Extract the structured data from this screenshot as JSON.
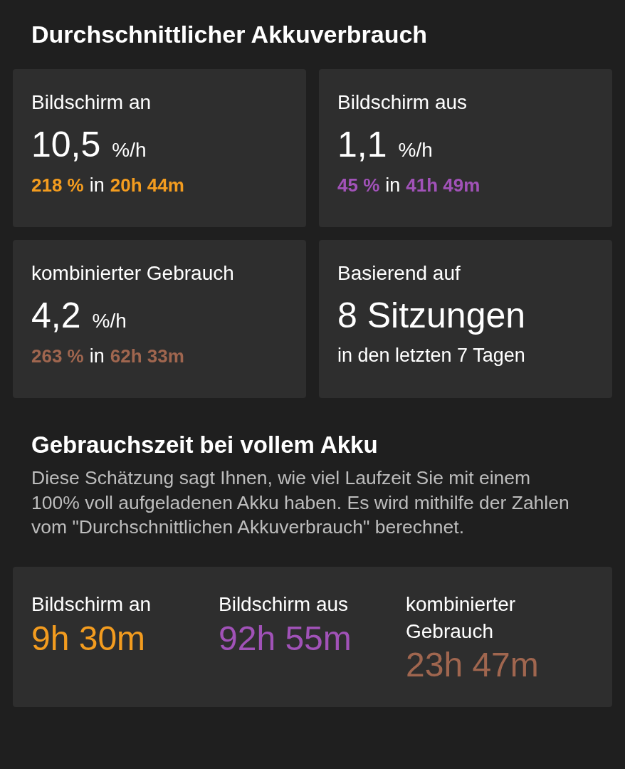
{
  "title": "Durchschnittlicher Akkuverbrauch",
  "cards": [
    {
      "kind": "rate",
      "label": "Bildschirm an",
      "value": "10,5",
      "unit": "%/h",
      "percent": "218 %",
      "connector": "in",
      "duration": "20h 44m",
      "color": "#f39c1f"
    },
    {
      "kind": "rate",
      "label": "Bildschirm aus",
      "value": "1,1",
      "unit": "%/h",
      "percent": "45 %",
      "connector": "in",
      "duration": "41h 49m",
      "color": "#a152b8"
    },
    {
      "kind": "rate",
      "label": "kombinierter Gebrauch",
      "value": "4,2",
      "unit": "%/h",
      "percent": "263 %",
      "connector": "in",
      "duration": "62h 33m",
      "color": "#a0664f"
    },
    {
      "kind": "sessions",
      "label": "Basierend auf",
      "value": "8 Sitzungen",
      "note": "in den letzten 7 Tagen"
    }
  ],
  "full_charge": {
    "title": "Gebrauchszeit bei vollem Akku",
    "description": "Diese Schätzung sagt Ihnen, wie viel Laufzeit Sie mit einem 100% voll aufgeladenen Akku haben. Es wird mithilfe der Zahlen vom \"Durchschnittlichen Akkuverbrauch\" berechnet.",
    "estimates": [
      {
        "label": "Bildschirm an",
        "value": "9h 30m",
        "color": "#f39c1f"
      },
      {
        "label": "Bildschirm aus",
        "value": "92h 55m",
        "color": "#a152b8"
      },
      {
        "label": "kombinierter Gebrauch",
        "value": "23h 47m",
        "color": "#a0664f"
      }
    ]
  }
}
